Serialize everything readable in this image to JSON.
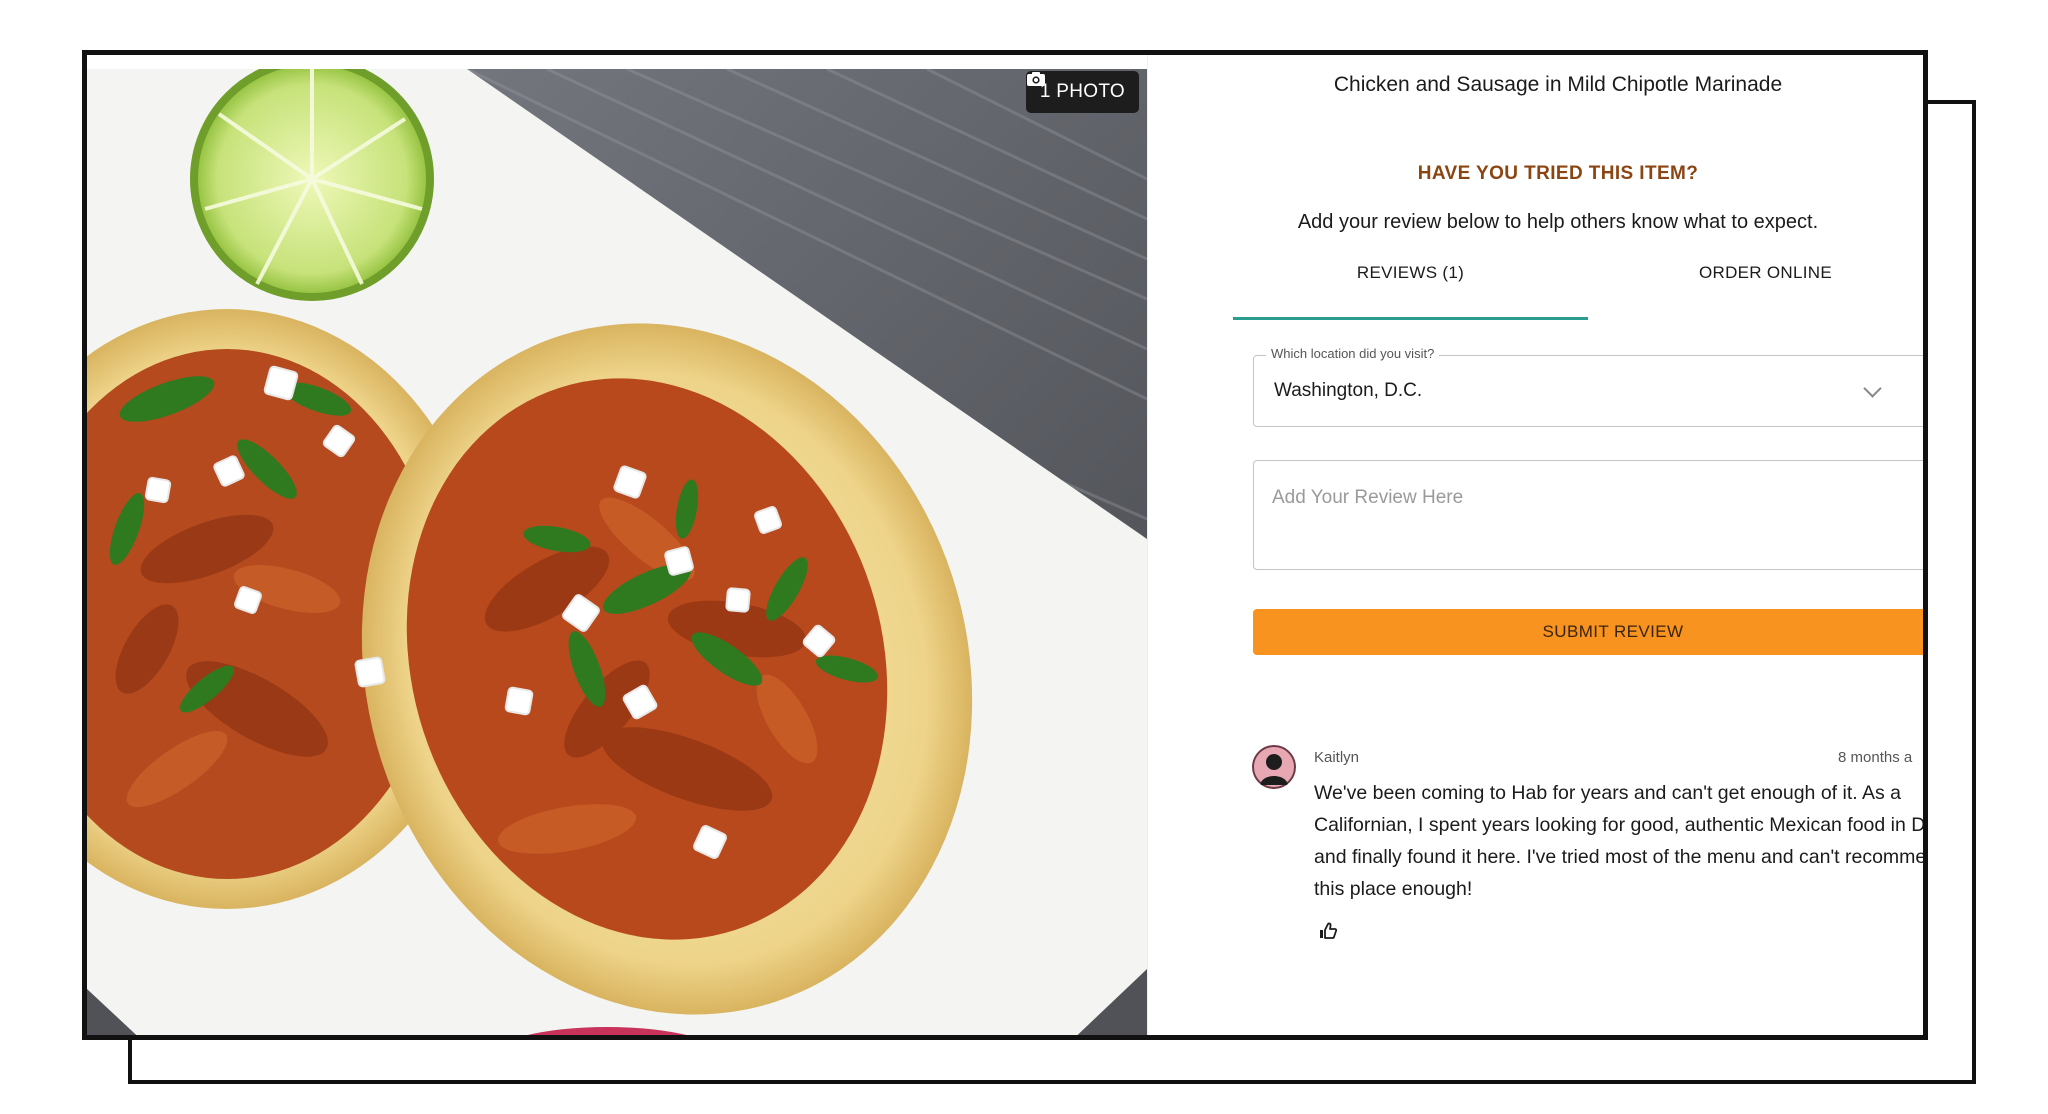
{
  "photo": {
    "badge_label": "1 PHOTO",
    "badge_icon": "camera-icon"
  },
  "item": {
    "title": "Chicken and Sausage in Mild Chipotle Marinade"
  },
  "prompt": {
    "heading": "HAVE YOU TRIED THIS ITEM?",
    "subtext": "Add your review below to help others know what to expect."
  },
  "tabs": [
    {
      "label": "REVIEWS (1)",
      "active": true
    },
    {
      "label": "ORDER ONLINE",
      "active": false
    }
  ],
  "form": {
    "location_label": "Which location did you visit?",
    "location_value": "Washington, D.C.",
    "review_placeholder": "Add Your Review Here",
    "submit_label": "SUBMIT REVIEW"
  },
  "reviews": [
    {
      "author": "Kaitlyn",
      "time": "8 months a",
      "text": "We've been coming to Hab for years and can't get enough of it. As a Californian, I spent years looking for good, authentic Mexican food in DC and finally found it here. I've tried most of the menu and can't recommend this place enough!"
    }
  ],
  "colors": {
    "accent_orange": "#f7931e",
    "heading_brown": "#8b4513",
    "tab_underline": "#2a9d8f"
  }
}
